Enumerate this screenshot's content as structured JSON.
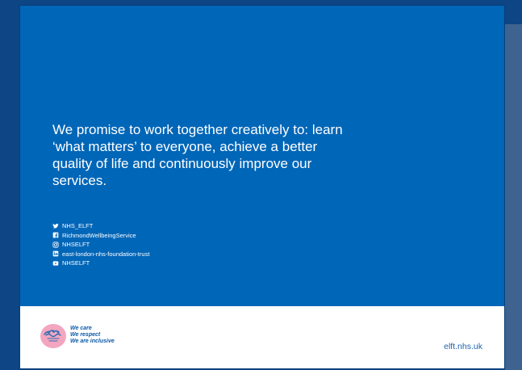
{
  "colors": {
    "outer_background": "#0d4585",
    "side_panel": "#3f6390",
    "leaflet_blue": "#0066b8",
    "footer_background": "#ffffff",
    "footer_text": "#0a57a8",
    "logo_pink": "#f4a6bf",
    "logo_blue": "#2c6db4"
  },
  "promise": "We promise to work together creatively to: learn ‘what matters’ to everyone, achieve a better quality of life and continuously improve our services.",
  "social": [
    {
      "platform": "twitter",
      "icon": "twitter-icon",
      "label": "NHS_ELFT"
    },
    {
      "platform": "facebook",
      "icon": "facebook-icon",
      "label": "RichmondWellbeingService"
    },
    {
      "platform": "instagram",
      "icon": "instagram-icon",
      "label": "NHSELFT"
    },
    {
      "platform": "linkedin",
      "icon": "linkedin-icon",
      "label": "east-london-nhs-foundation-trust"
    },
    {
      "platform": "youtube",
      "icon": "youtube-icon",
      "label": "NHSELFT"
    }
  ],
  "footer": {
    "logo_icon": "care-respect-inclusive-logo",
    "values": [
      "We care",
      "We respect",
      "We are inclusive"
    ],
    "website": "elft.nhs.uk"
  }
}
